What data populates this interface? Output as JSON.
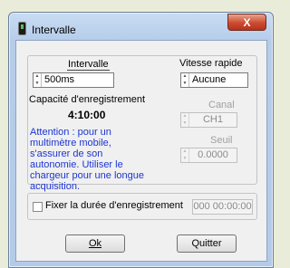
{
  "window": {
    "title": "Intervalle",
    "close_label": "X"
  },
  "interval": {
    "label": "Intervalle",
    "value": "500ms"
  },
  "fast_speed": {
    "label": "Vitesse rapide",
    "value": "Aucune"
  },
  "capacity": {
    "label": "Capacité d'enregistrement",
    "value": "4:10:00"
  },
  "warning": "Attention : pour un multimètre mobile, s'assurer de son autonomie. Utiliser le chargeur pour une longue acquisition.",
  "channel": {
    "label": "Canal",
    "value": "CH1"
  },
  "threshold": {
    "label": "Seuil",
    "value": "0.0000"
  },
  "fixed_duration": {
    "label": "Fixer la durée d'enregistrement",
    "value": "000 00:00:00",
    "checked": false
  },
  "buttons": {
    "ok": "Ok",
    "quit": "Quitter"
  },
  "colors": {
    "warning_text": "#1c35d3",
    "close_button": "#cc4b2f",
    "title_bar": "#b9cfea"
  }
}
